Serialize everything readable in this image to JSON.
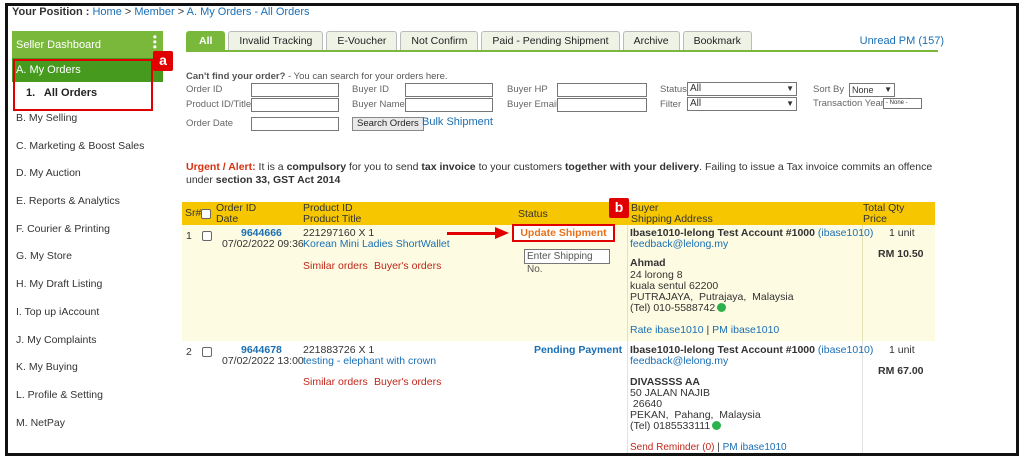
{
  "breadcrumb": {
    "label": "Your Position :",
    "items": [
      "Home",
      "Member",
      "A. My Orders - All Orders"
    ]
  },
  "sidebar": {
    "header": "Seller Dashboard",
    "active_section": "A. My Orders",
    "active_sub": "1.   All Orders",
    "items": [
      "B. My Selling",
      "C. Marketing & Boost Sales",
      "D. My Auction",
      "E. Reports & Analytics",
      "F. Courier & Printing",
      "G. My Store",
      "H. My Draft Listing",
      "I. Top up iAccount",
      "J. My Complaints",
      "K. My Buying",
      "L. Profile & Setting",
      "M. NetPay"
    ]
  },
  "annotations": {
    "a": "a",
    "b": "b"
  },
  "tabs": [
    "All",
    "Invalid Tracking",
    "E-Voucher",
    "Not Confirm",
    "Paid - Pending Shipment",
    "Archive",
    "Bookmark"
  ],
  "unread_pm": "Unread PM (157)",
  "search": {
    "intro_bold": "Can't find your order?",
    "intro_rest": " - You can search for your orders here.",
    "labels": {
      "order_id": "Order ID",
      "product": "Product ID/Title",
      "order_date": "Order Date",
      "buyer_id": "Buyer ID",
      "buyer_name": "Buyer Name",
      "buyer_hp": "Buyer HP",
      "buyer_email": "Buyer Email",
      "status": "Status",
      "filter": "Filter",
      "sort_by": "Sort By",
      "transaction_year": "Transaction Year"
    },
    "status_value": "All",
    "filter_value": "All",
    "sort_value": "None",
    "year_value": "- None -",
    "search_button": "Search Orders",
    "bulk_shipment": "Bulk Shipment"
  },
  "alert": {
    "prefix": "Urgent / Alert:",
    "t1": " It is a ",
    "b1": "compulsory",
    "t2": " for you to send ",
    "b2": "tax invoice",
    "t3": " to your customers ",
    "b3": "together with your delivery",
    "t4": ". Failing to issue a Tax invoice commits an offence under ",
    "b4": "section 33, GST Act 2014"
  },
  "table": {
    "headers": {
      "sr": "Sr#",
      "order_id": "Order ID",
      "date": "Date",
      "product_id": "Product ID",
      "product_title": "Product Title",
      "status": "Status",
      "buyer": "Buyer",
      "shipping": "Shipping Address",
      "total_qty": "Total Qty",
      "price": "Price"
    },
    "rows": [
      {
        "sr": "1",
        "order_id": "9644666",
        "date": "07/02/2022 09:36",
        "product_id": "221297160 X 1",
        "product_title": "Korean Mini Ladies ShortWallet",
        "similar": "Similar orders",
        "buyers_orders": "Buyer's orders",
        "status_button": "Update Shipment",
        "shipping_placeholder": "Enter Shipping No.",
        "buyer": "Ibase1010-lelong Test Account #1000",
        "buyer_id": "(ibase1010)",
        "email": "feedback@lelong.my",
        "name": "Ahmad",
        "addr1": "24 lorong 8",
        "addr2": "kuala sentul 62200",
        "addr3": "PUTRAJAYA,  Putrajaya,  Malaysia",
        "tel": "(Tel) 010-5588742",
        "rate": "Rate ibase1010",
        "pm": "PM ibase1010",
        "qty": "1 unit",
        "price": "RM 10.50"
      },
      {
        "sr": "2",
        "order_id": "9644678",
        "date": "07/02/2022 13:00",
        "product_id": "221883726 X 1",
        "product_title": "testing - elephant with crown",
        "similar": "Similar orders",
        "buyers_orders": "Buyer's orders",
        "status": "Pending Payment",
        "buyer": "Ibase1010-lelong Test Account #1000",
        "buyer_id": "(ibase1010)",
        "email": "feedback@lelong.my",
        "name": "DIVASSSS AA",
        "addr1": "50 JALAN NAJIB",
        "addr2": " 26640",
        "addr3": "PEKAN,  Pahang,  Malaysia",
        "tel": "(Tel) 0185533111",
        "reminder": "Send Reminder (0)",
        "pm": "PM ibase1010",
        "qty": "1 unit",
        "price": "RM 67.00"
      }
    ]
  },
  "colors": {
    "green": "#7ab83c",
    "dark_green": "#469b1e",
    "header_yellow": "#f6c700",
    "annotation_red": "#e00000",
    "link_blue": "#1a6fb5"
  }
}
